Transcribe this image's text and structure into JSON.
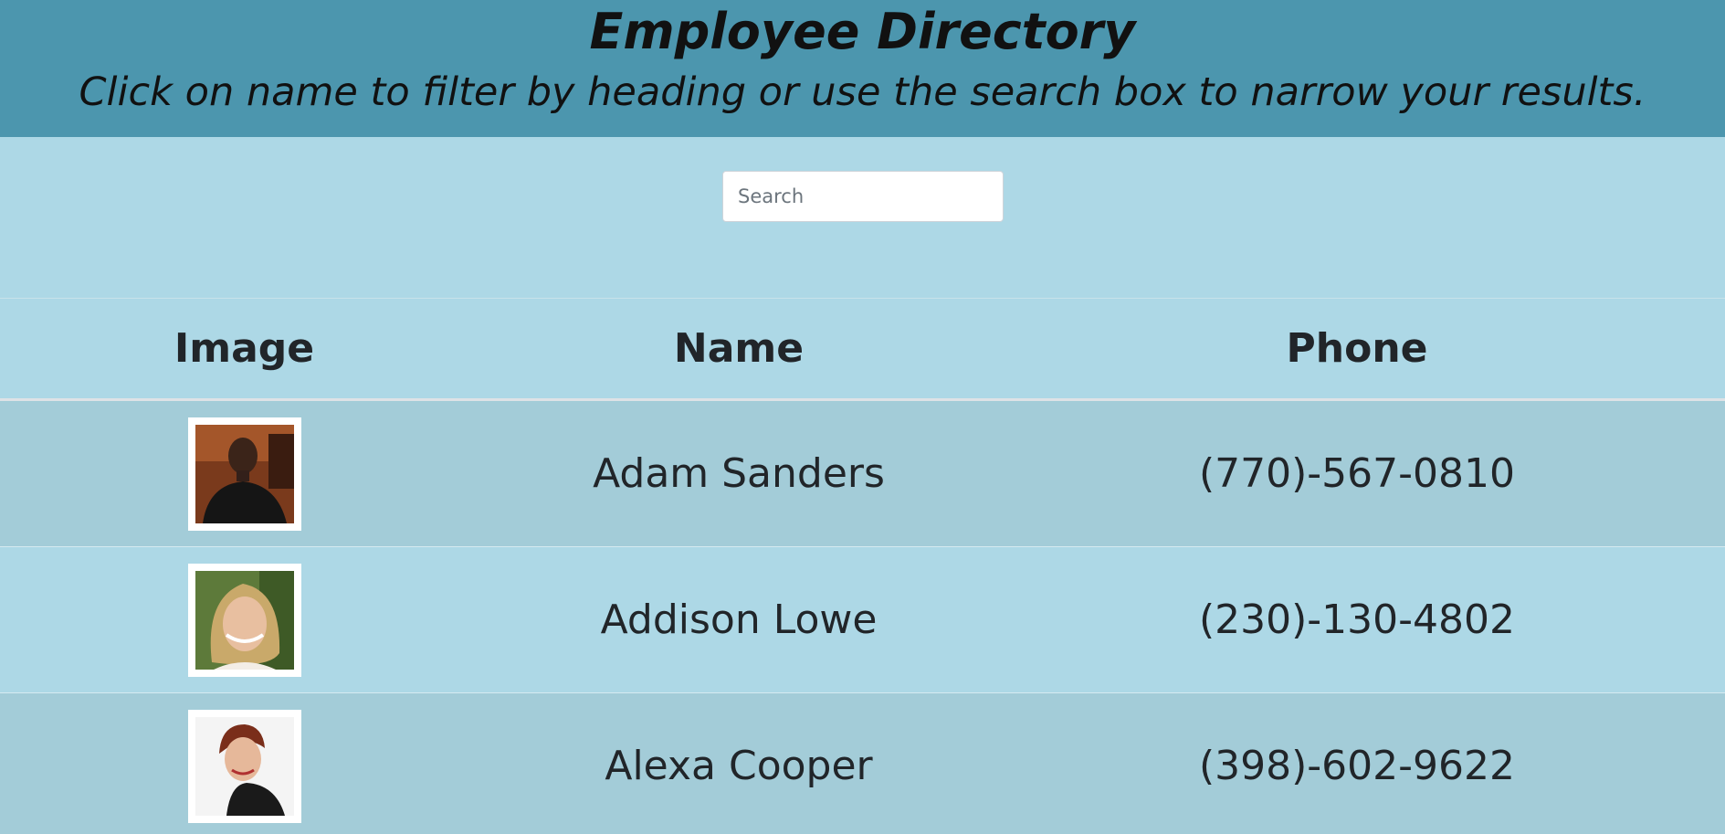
{
  "header": {
    "title": "Employee Directory",
    "subtitle": "Click on name to filter by heading or use the search box to narrow your results."
  },
  "search": {
    "placeholder": "Search",
    "value": ""
  },
  "table": {
    "columns": [
      "Image",
      "Name",
      "Phone"
    ],
    "rows": [
      {
        "image": "employee-photo",
        "name": "Adam Sanders",
        "phone": "(770)-567-0810"
      },
      {
        "image": "employee-photo",
        "name": "Addison Lowe",
        "phone": "(230)-130-4802"
      },
      {
        "image": "employee-photo",
        "name": "Alexa Cooper",
        "phone": "(398)-602-9622"
      }
    ]
  },
  "colors": {
    "header_bg": "#4c96ae",
    "page_bg": "#add8e6",
    "row_alt_bg": "#a3ccd8"
  }
}
